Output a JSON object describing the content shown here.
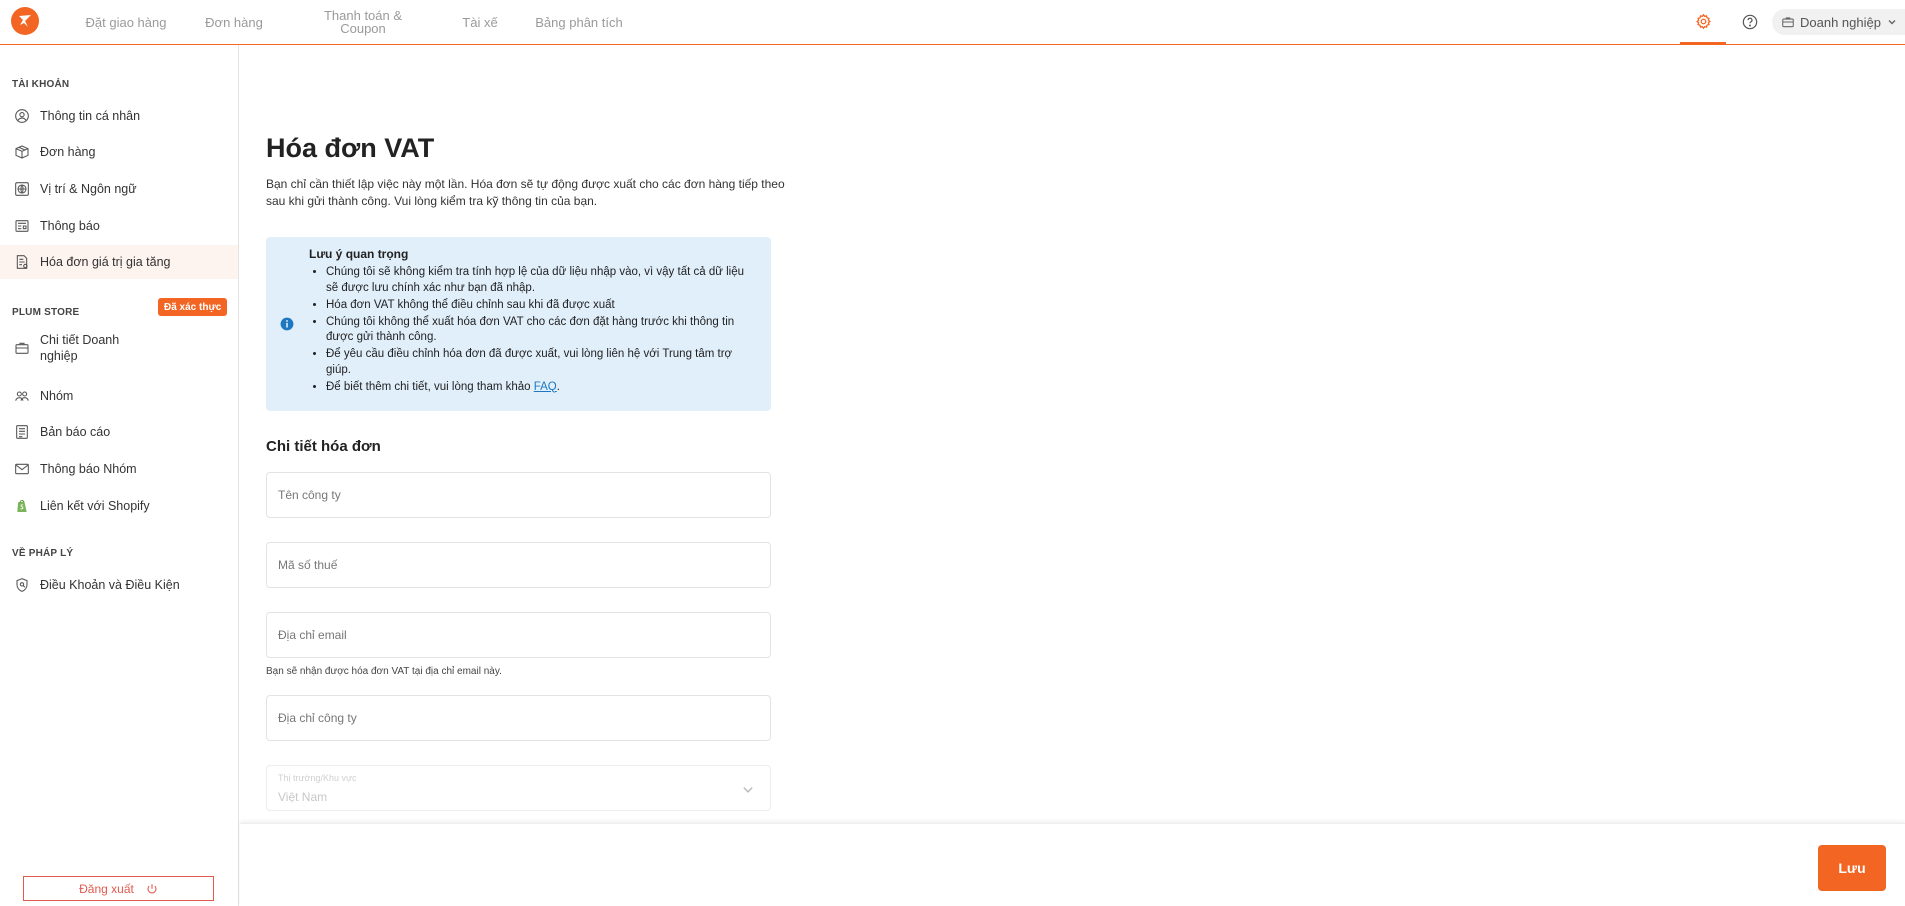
{
  "nav": {
    "items": [
      {
        "label": "Đặt giao hàng"
      },
      {
        "label": "Đơn hàng"
      },
      {
        "label": "Thanh toán & Coupon"
      },
      {
        "label": "Tài xế"
      },
      {
        "label": "Bảng phân tích"
      }
    ],
    "account_label": "Doanh nghiệp"
  },
  "sidebar": {
    "sections": [
      {
        "title": "TÀI KHOẢN",
        "items": [
          {
            "label": "Thông tin cá nhân",
            "icon": "user-circle-icon"
          },
          {
            "label": "Đơn hàng",
            "icon": "package-icon"
          },
          {
            "label": "Vị trí & Ngôn ngữ",
            "icon": "globe-icon"
          },
          {
            "label": "Thông báo",
            "icon": "newspaper-icon"
          },
          {
            "label": "Hóa đơn giá trị gia tăng",
            "icon": "invoice-icon",
            "active": true
          }
        ]
      },
      {
        "title": "PLUM STORE",
        "items": [
          {
            "label": "Chi tiết Doanh nghiệp",
            "icon": "briefcase-icon",
            "badge": "Đã xác thực"
          },
          {
            "label": "Nhóm",
            "icon": "group-icon"
          },
          {
            "label": "Bản báo cáo",
            "icon": "report-icon"
          },
          {
            "label": "Thông báo Nhóm",
            "icon": "mail-icon"
          },
          {
            "label": "Liên kết với Shopify",
            "icon": "shopify-icon"
          }
        ]
      },
      {
        "title": "VỀ PHÁP LÝ",
        "items": [
          {
            "label": "Điều Khoản và Điều Kiện",
            "icon": "shield-icon"
          }
        ]
      }
    ],
    "logout_label": "Đăng xuất"
  },
  "main": {
    "title": "Hóa đơn VAT",
    "intro": "Bạn chỉ cần thiết lập việc này một lần. Hóa đơn sẽ tự động được xuất cho các đơn hàng tiếp theo sau khi gửi thành công. Vui lòng kiểm tra kỹ thông tin của bạn.",
    "notice": {
      "title": "Lưu ý quan trọng",
      "items": [
        "Chúng tôi sẽ không kiểm tra tính hợp lệ của dữ liệu nhập vào, vì vậy tất cả dữ liệu sẽ được lưu chính xác như bạn đã nhập.",
        "Hóa đơn VAT không thể điều chỉnh sau khi đã được xuất",
        "Chúng tôi không thể xuất hóa đơn VAT cho các đơn đặt hàng trước khi thông tin được gửi thành công.",
        "Để yêu cầu điều chỉnh hóa đơn đã được xuất, vui lòng liên hệ với Trung tâm trợ giúp."
      ],
      "faq_prefix": "Để biết thêm chi tiết, vui lòng tham khảo ",
      "faq_link": "FAQ",
      "faq_suffix": "."
    },
    "details_title": "Chi tiết hóa đơn",
    "fields": {
      "company_name": {
        "placeholder": "Tên công ty"
      },
      "tax_code": {
        "placeholder": "Mã số thuế"
      },
      "email": {
        "placeholder": "Địa chỉ email"
      },
      "email_hint": "Bạn sẽ nhận được hóa đơn VAT tại địa chỉ email này.",
      "company_address": {
        "placeholder": "Địa chỉ công ty"
      },
      "market": {
        "label": "Thị trường/Khu vực",
        "value": "Việt Nam"
      }
    },
    "save_label": "Lưu"
  },
  "colors": {
    "accent": "#f26522",
    "notice_bg": "#e1effb",
    "link": "#1d78c1",
    "logout": "#e05a4e"
  }
}
